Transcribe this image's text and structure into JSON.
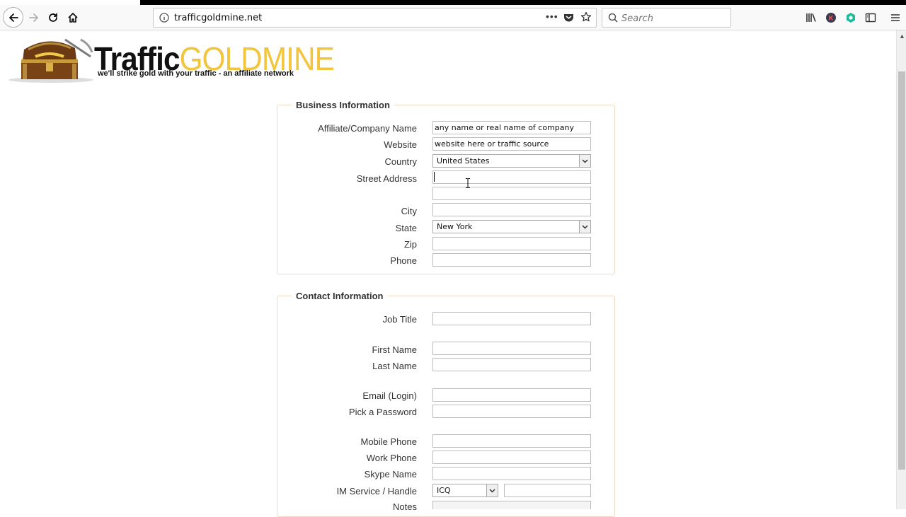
{
  "browser": {
    "url": "trafficgoldmine.net",
    "search_placeholder": "Search",
    "icons": [
      "back-icon",
      "forward-icon",
      "reload-icon",
      "home-icon",
      "site-info-icon",
      "page-actions-icon",
      "pocket-icon",
      "bookmark-star-icon",
      "search-icon",
      "library-icon",
      "account-icon",
      "extension-icon",
      "sidebar-icon",
      "menu-icon"
    ]
  },
  "logo": {
    "word_traffic": "Traffic",
    "word_gold": "GOLDMINE",
    "tagline": "we'll strike gold with your traffic - an affiliate network",
    "brand_gold": "#f2c53d"
  },
  "business": {
    "legend": "Business Information",
    "company_label": "Affiliate/Company Name",
    "company_value": "any name or real name of company",
    "website_label": "Website",
    "website_value": "website here or traffic source",
    "country_label": "Country",
    "country_value": "United States",
    "street_label": "Street Address",
    "street1_value": "",
    "street2_value": "",
    "city_label": "City",
    "city_value": "",
    "state_label": "State",
    "state_value": "New York",
    "zip_label": "Zip",
    "zip_value": "",
    "phone_label": "Phone",
    "phone_value": ""
  },
  "contact": {
    "legend": "Contact Information",
    "job_title_label": "Job Title",
    "first_name_label": "First Name",
    "last_name_label": "Last Name",
    "email_label": "Email (Login)",
    "password_label": "Pick a Password",
    "mobile_label": "Mobile Phone",
    "work_label": "Work Phone",
    "skype_label": "Skype Name",
    "im_label": "IM Service / Handle",
    "im_service_value": "ICQ",
    "notes_label": "Notes"
  }
}
